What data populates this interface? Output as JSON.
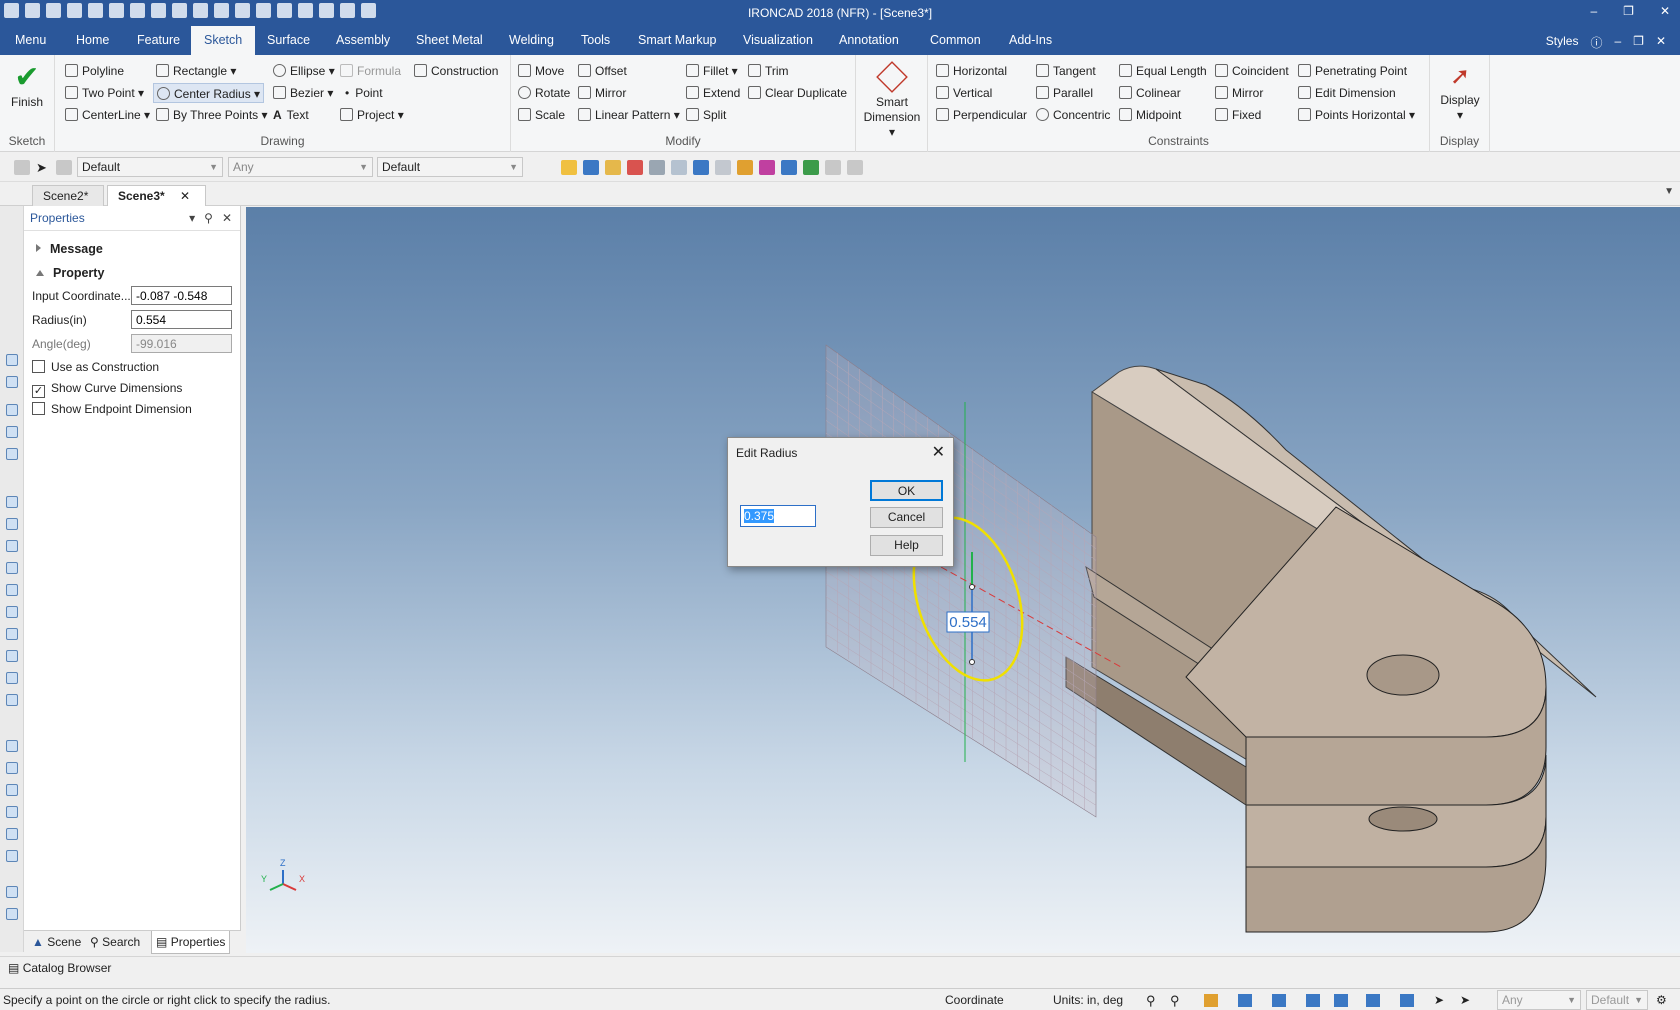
{
  "app": {
    "title": "IRONCAD 2018 (NFR) - [Scene3*]"
  },
  "menu": {
    "tabs": [
      "Menu",
      "Home",
      "Feature",
      "Sketch",
      "Surface",
      "Assembly",
      "Sheet Metal",
      "Welding",
      "Tools",
      "Smart Markup",
      "Visualization",
      "Annotation",
      "Common",
      "Add-Ins"
    ],
    "active": "Sketch",
    "styles_label": "Styles"
  },
  "ribbon": {
    "sketch_group": {
      "finish": "Finish",
      "label": "Sketch"
    },
    "drawing_group": {
      "label": "Drawing",
      "col1": [
        "Polyline",
        "Two Point",
        "CenterLine"
      ],
      "col2": [
        "Rectangle",
        "Center Radius",
        "By Three Points"
      ],
      "col3": [
        "Ellipse",
        "Bezier",
        "Text"
      ],
      "col4": [
        "Formula",
        "Point",
        "Project"
      ],
      "col5": [
        "Construction"
      ]
    },
    "modify_group": {
      "label": "Modify",
      "col1": [
        "Move",
        "Rotate",
        "Scale"
      ],
      "col2": [
        "Offset",
        "Mirror",
        "Linear Pattern"
      ],
      "col3": [
        "Fillet",
        "Extend",
        "Split"
      ],
      "col4": [
        "Trim",
        "Clear Duplicate"
      ]
    },
    "smart_dimension": {
      "line1": "Smart",
      "line2": "Dimension"
    },
    "constraints_group": {
      "label": "Constraints",
      "col1": [
        "Horizontal",
        "Vertical",
        "Perpendicular"
      ],
      "col2": [
        "Tangent",
        "Parallel",
        "Concentric"
      ],
      "col3": [
        "Equal Length",
        "Colinear",
        "Midpoint"
      ],
      "col4": [
        "Coincident",
        "Mirror",
        "Fixed"
      ],
      "col5": [
        "Penetrating Point",
        "Edit Dimension",
        "Points Horizontal"
      ]
    },
    "display_group": {
      "button": "Display",
      "label": "Display"
    }
  },
  "toolbar2": {
    "combo1": "Default",
    "combo2": "Any",
    "combo3": "Default"
  },
  "doc_tabs": [
    "Scene2*",
    "Scene3*"
  ],
  "properties": {
    "title": "Properties",
    "sections": {
      "message": "Message",
      "property": "Property"
    },
    "fields": [
      {
        "label": "Input Coordinate...",
        "value": "-0.087 -0.548"
      },
      {
        "label": "Radius(in)",
        "value": "0.554"
      },
      {
        "label": "Angle(deg)",
        "value": "-99.016"
      }
    ],
    "checkboxes": [
      {
        "label": "Use as Construction",
        "checked": false
      },
      {
        "label": "Show Curve Dimensions",
        "checked": true
      },
      {
        "label": "Show Endpoint Dimension",
        "checked": false
      }
    ],
    "bottom_tabs": [
      "Scene",
      "Search",
      "Properties"
    ]
  },
  "catalog_browser": "Catalog Browser",
  "viewport": {
    "dimension_label": "0.554",
    "triad": {
      "x": "X",
      "y": "Y",
      "z": "Z"
    }
  },
  "dialog": {
    "title": "Edit Radius",
    "value": "0.375",
    "ok": "OK",
    "cancel": "Cancel",
    "help": "Help"
  },
  "status": {
    "message": "Specify a point on the circle or right click to specify the radius.",
    "coordinate": "Coordinate",
    "units": "Units: in, deg",
    "combo_any": "Any",
    "combo_default": "Default"
  },
  "colors": {
    "accent": "#2b579a",
    "sketch_curve": "#f0e000",
    "part": "#b9aa9c"
  }
}
